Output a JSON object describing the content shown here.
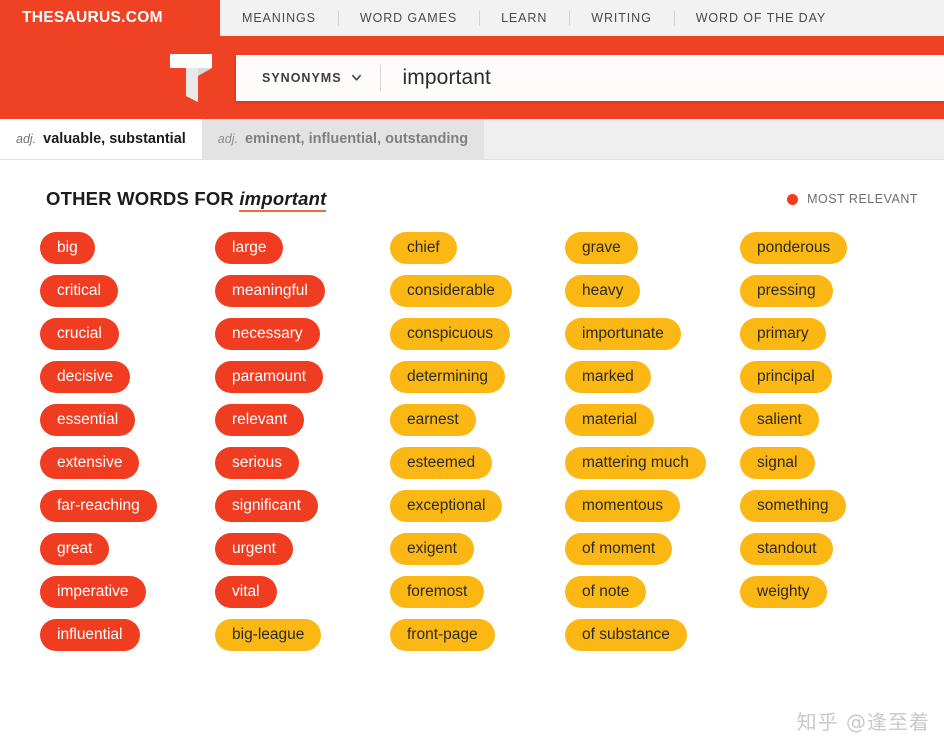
{
  "topnav": {
    "brand": "THESAURUS.COM",
    "links": [
      {
        "label": "MEANINGS"
      },
      {
        "label": "WORD GAMES"
      },
      {
        "label": "LEARN"
      },
      {
        "label": "WRITING"
      },
      {
        "label": "WORD OF THE DAY"
      }
    ]
  },
  "search": {
    "logo_icon": "thesaurus-t-logo-icon",
    "selector_label": "SYNONYMS",
    "selector_icon": "chevron-down-icon",
    "query": "important"
  },
  "pos_tabs": [
    {
      "pos": "adj.",
      "words": "valuable, substantial",
      "active": true
    },
    {
      "pos": "adj.",
      "words": "eminent, influential, outstanding",
      "active": false
    }
  ],
  "section": {
    "title_prefix": "OTHER WORDS FOR",
    "title_term": "important",
    "legend_icon": "relevance-dot-icon",
    "legend_label": "MOST RELEVANT"
  },
  "colors": {
    "brand_red": "#ef4123",
    "chip_hot": "#f03d21",
    "chip_mid": "#fbb713",
    "nav_bg": "#f2f2f2",
    "tab_active_bg": "#ffffff",
    "tab_inactive_bg": "#e3e3e3"
  },
  "synonym_columns": [
    {
      "chips": [
        {
          "word": "big",
          "level": "hot"
        },
        {
          "word": "critical",
          "level": "hot"
        },
        {
          "word": "crucial",
          "level": "hot"
        },
        {
          "word": "decisive",
          "level": "hot"
        },
        {
          "word": "essential",
          "level": "hot"
        },
        {
          "word": "extensive",
          "level": "hot"
        },
        {
          "word": "far-reaching",
          "level": "hot"
        },
        {
          "word": "great",
          "level": "hot"
        },
        {
          "word": "imperative",
          "level": "hot"
        },
        {
          "word": "influential",
          "level": "hot"
        }
      ]
    },
    {
      "chips": [
        {
          "word": "large",
          "level": "hot"
        },
        {
          "word": "meaningful",
          "level": "hot"
        },
        {
          "word": "necessary",
          "level": "hot"
        },
        {
          "word": "paramount",
          "level": "hot"
        },
        {
          "word": "relevant",
          "level": "hot"
        },
        {
          "word": "serious",
          "level": "hot"
        },
        {
          "word": "significant",
          "level": "hot"
        },
        {
          "word": "urgent",
          "level": "hot"
        },
        {
          "word": "vital",
          "level": "hot"
        },
        {
          "word": "big-league",
          "level": "mid"
        }
      ]
    },
    {
      "chips": [
        {
          "word": "chief",
          "level": "mid"
        },
        {
          "word": "considerable",
          "level": "mid"
        },
        {
          "word": "conspicuous",
          "level": "mid"
        },
        {
          "word": "determining",
          "level": "mid"
        },
        {
          "word": "earnest",
          "level": "mid"
        },
        {
          "word": "esteemed",
          "level": "mid"
        },
        {
          "word": "exceptional",
          "level": "mid"
        },
        {
          "word": "exigent",
          "level": "mid"
        },
        {
          "word": "foremost",
          "level": "mid"
        },
        {
          "word": "front-page",
          "level": "mid"
        }
      ]
    },
    {
      "chips": [
        {
          "word": "grave",
          "level": "mid"
        },
        {
          "word": "heavy",
          "level": "mid"
        },
        {
          "word": "importunate",
          "level": "mid"
        },
        {
          "word": "marked",
          "level": "mid"
        },
        {
          "word": "material",
          "level": "mid"
        },
        {
          "word": "mattering much",
          "level": "mid"
        },
        {
          "word": "momentous",
          "level": "mid"
        },
        {
          "word": "of moment",
          "level": "mid"
        },
        {
          "word": "of note",
          "level": "mid"
        },
        {
          "word": "of substance",
          "level": "mid"
        }
      ]
    },
    {
      "chips": [
        {
          "word": "ponderous",
          "level": "mid"
        },
        {
          "word": "pressing",
          "level": "mid"
        },
        {
          "word": "primary",
          "level": "mid"
        },
        {
          "word": "principal",
          "level": "mid"
        },
        {
          "word": "salient",
          "level": "mid"
        },
        {
          "word": "signal",
          "level": "mid"
        },
        {
          "word": "something",
          "level": "mid"
        },
        {
          "word": "standout",
          "level": "mid"
        },
        {
          "word": "weighty",
          "level": "mid"
        }
      ]
    }
  ],
  "watermark": "知乎 @逢至着"
}
